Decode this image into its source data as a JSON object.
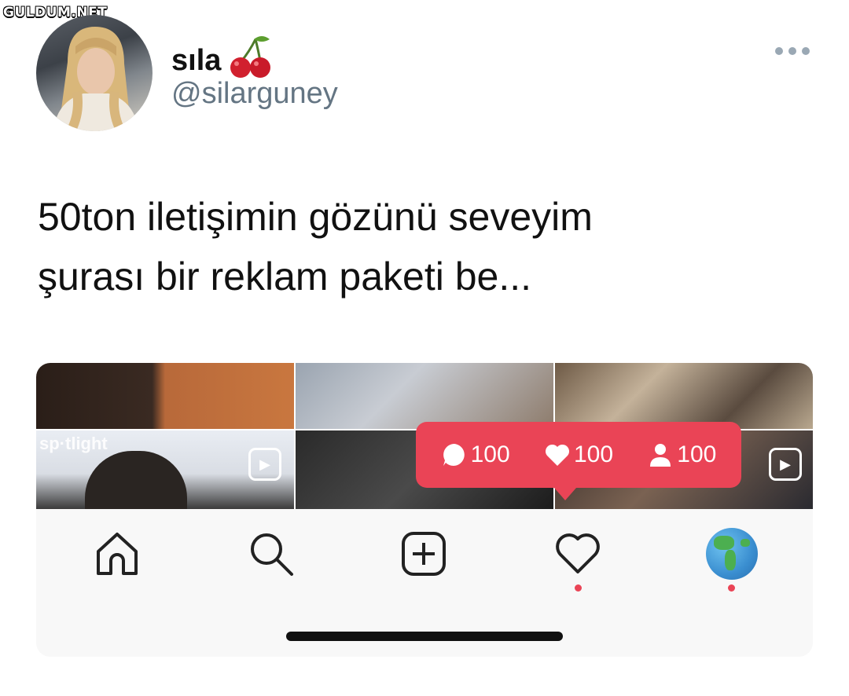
{
  "watermark": "GULDUM.NET",
  "author": {
    "name": "sıla",
    "name_emoji": "cherry-icon",
    "handle": "@silarguney"
  },
  "tweet": {
    "lines": [
      "50ton iletişimin gözünü seveyim",
      "şurası bir reklam paketi be..."
    ]
  },
  "screenshot": {
    "grid_tiles": [
      {
        "label": ""
      },
      {
        "label": ""
      },
      {
        "label": ""
      },
      {
        "label": "sp·tlight"
      },
      {
        "label": ""
      },
      {
        "label": ""
      }
    ],
    "notification": {
      "comments": "100",
      "likes": "100",
      "followers": "100",
      "color": "#ea4456"
    },
    "nav": [
      {
        "icon": "home-icon"
      },
      {
        "icon": "search-icon"
      },
      {
        "icon": "add-post-icon"
      },
      {
        "icon": "heart-icon",
        "badge": true
      },
      {
        "icon": "globe-profile-icon",
        "badge": true
      }
    ]
  },
  "colors": {
    "handle": "#647583",
    "notification": "#ea4456"
  }
}
